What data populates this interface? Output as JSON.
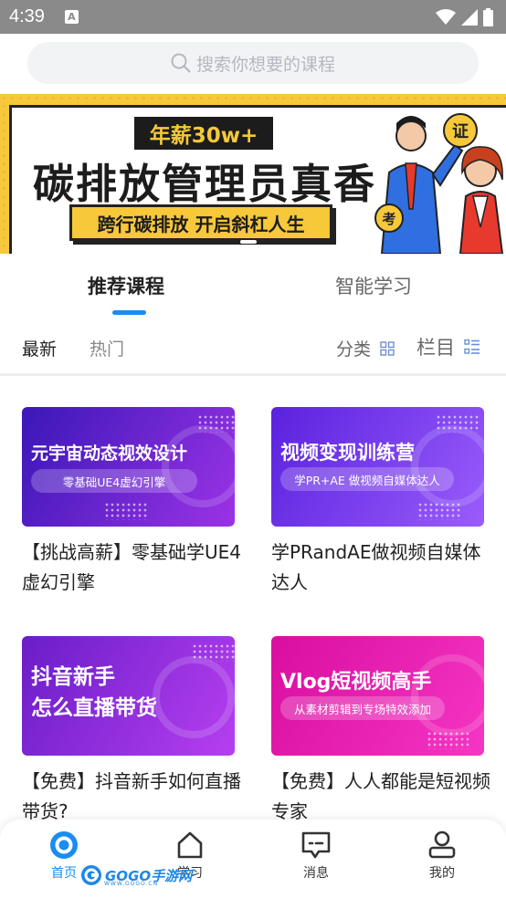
{
  "status_bar": {
    "time": "4:39",
    "notification_letter": "A"
  },
  "search": {
    "placeholder": "搜索你想要的课程"
  },
  "banner": {
    "tag": "年薪30w+",
    "headline": "碳排放管理员真香",
    "subline": "跨行碳排放 开启斜杠人生",
    "badge_top": "证",
    "badge_bottom": "考"
  },
  "main_tabs": [
    {
      "label": "推荐课程",
      "active": true
    },
    {
      "label": "智能学习",
      "active": false
    }
  ],
  "filters": {
    "sort": [
      {
        "label": "最新",
        "active": true
      },
      {
        "label": "热门",
        "active": false
      }
    ],
    "category_label": "分类",
    "column_label": "栏目"
  },
  "courses": [
    {
      "thumb_title": "元宇宙动态视效设计",
      "thumb_sub": "零基础UE4虚幻引擎",
      "title": "【挑战高薪】零基础学UE4虚幻引擎",
      "colors": [
        "#4a1fc9",
        "#9b33e6"
      ]
    },
    {
      "thumb_title": "视频变现训练营",
      "thumb_sub": "学PR+AE 做视频自媒体达人",
      "title": "学PRandAE做视频自媒体达人",
      "colors": [
        "#6a2ee8",
        "#8f4dfa"
      ]
    },
    {
      "thumb_title": "抖音新手\n怎么直播带货",
      "thumb_sub": "",
      "title": "【免费】抖音新手如何直播带货?",
      "colors": [
        "#7a22d8",
        "#b13ef0"
      ]
    },
    {
      "thumb_title": "Vlog短视频高手",
      "thumb_sub": "从素材剪辑到专场特效添加",
      "title": "【免费】人人都能是短视频专家",
      "colors": [
        "#e014a6",
        "#f52ec0"
      ]
    }
  ],
  "bottom_nav": [
    {
      "label": "首页",
      "icon": "home-ring-icon",
      "active": true
    },
    {
      "label": "学习",
      "icon": "house-icon",
      "active": false
    },
    {
      "label": "消息",
      "icon": "message-icon",
      "active": false
    },
    {
      "label": "我的",
      "icon": "profile-icon",
      "active": false
    }
  ],
  "watermark": {
    "text": "GOGO手游网",
    "sub": "WWW.GOGO.CN"
  },
  "accent_color": "#1a8cf2"
}
